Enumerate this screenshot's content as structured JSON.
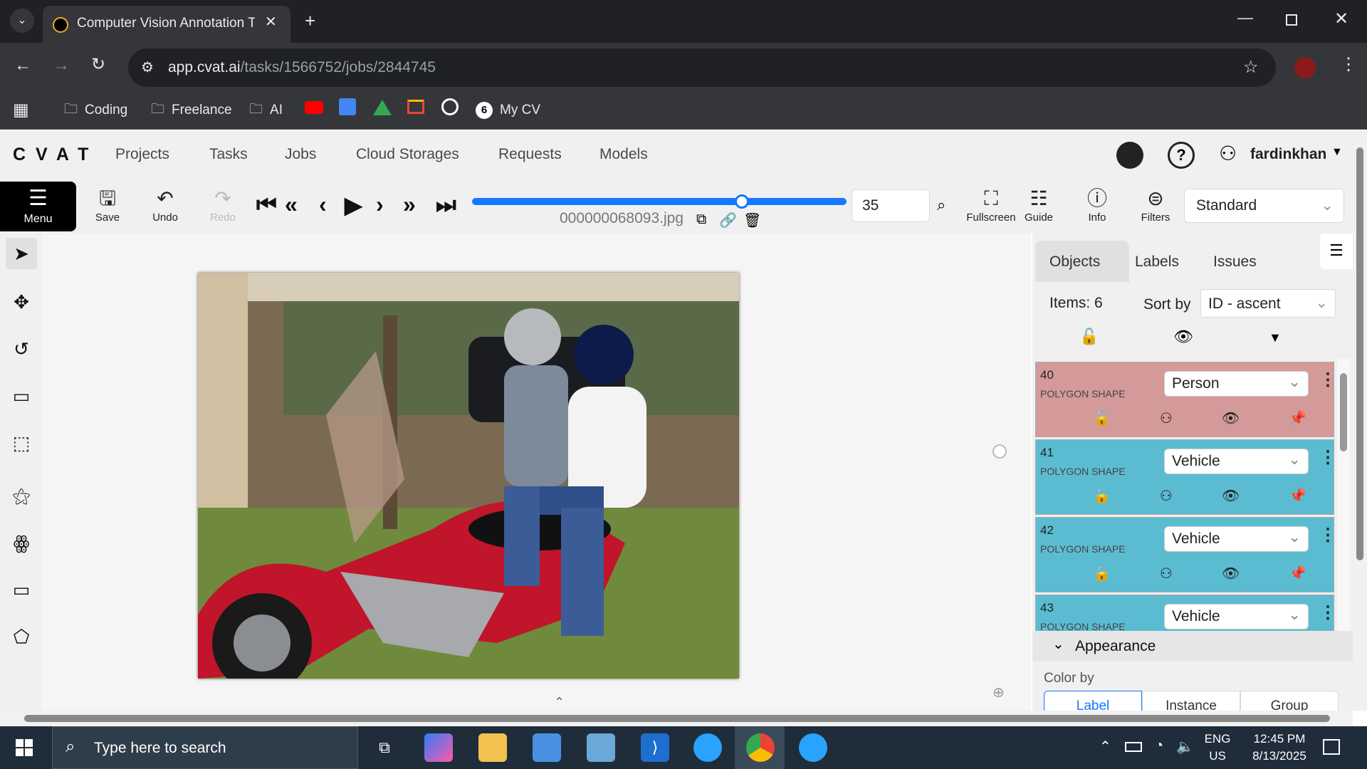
{
  "browser": {
    "tab_title": "Computer Vision Annotation To",
    "url_host": "app.cvat.ai",
    "url_path": "/tasks/1566752/jobs/2844745",
    "bookmarks": [
      "Coding",
      "Freelance",
      "AI",
      "My CV"
    ]
  },
  "app": {
    "logo": "CVAT",
    "nav": [
      "Projects",
      "Tasks",
      "Jobs",
      "Cloud Storages",
      "Requests",
      "Models"
    ],
    "username": "fardinkhan"
  },
  "toolbar": {
    "menu": "Menu",
    "save": "Save",
    "undo": "Undo",
    "redo": "Redo",
    "frame_name": "000000068093.jpg",
    "frame_number": "35",
    "frame_progress": 0.72,
    "fullscreen": "Fullscreen",
    "guide": "Guide",
    "info": "Info",
    "filters": "Filters",
    "workspace": "Standard"
  },
  "sidebar": {
    "tabs": [
      "Objects",
      "Labels",
      "Issues"
    ],
    "items_count": "Items: 6",
    "sort_label": "Sort by",
    "sort_value": "ID - ascent",
    "objects": [
      {
        "id": "40",
        "type": "POLYGON SHAPE",
        "label": "Person",
        "color": "#d49a9a"
      },
      {
        "id": "41",
        "type": "POLYGON SHAPE",
        "label": "Vehicle",
        "color": "#5bbcd1"
      },
      {
        "id": "42",
        "type": "POLYGON SHAPE",
        "label": "Vehicle",
        "color": "#5bbcd1"
      },
      {
        "id": "43",
        "type": "POLYGON SHAPE",
        "label": "Vehicle",
        "color": "#5bbcd1"
      }
    ],
    "appearance_title": "Appearance",
    "color_by_label": "Color by",
    "color_by_options": [
      "Label",
      "Instance",
      "Group"
    ]
  },
  "taskbar": {
    "search_placeholder": "Type here to search",
    "lang": "ENG",
    "region": "US",
    "time": "12:45 PM",
    "date": "8/13/2025"
  }
}
